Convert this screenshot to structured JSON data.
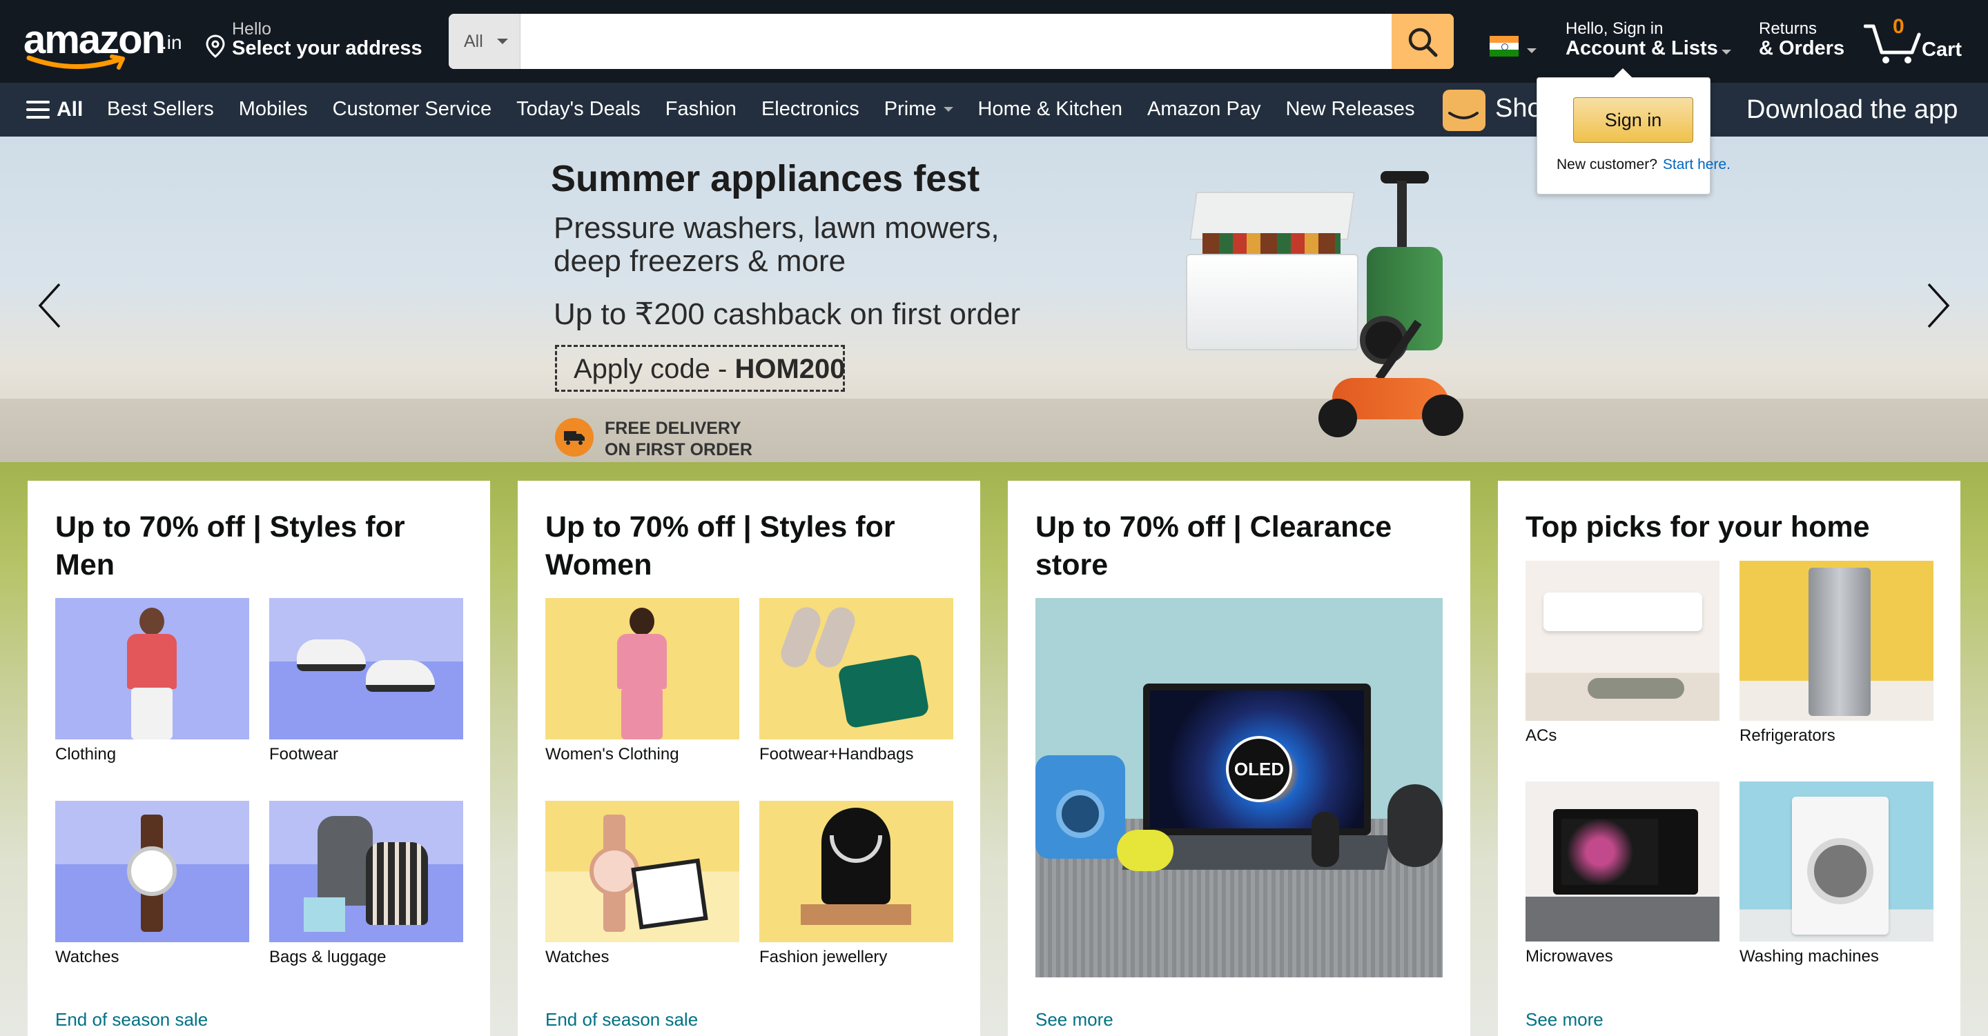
{
  "header": {
    "logo_text": "amazon",
    "logo_tld": ".in",
    "address_hello": "Hello",
    "address_label": "Select your address",
    "search_category": "All",
    "search_placeholder": "",
    "account_greeting": "Hello, Sign in",
    "account_label": "Account & Lists",
    "returns_line1": "Returns",
    "returns_line2": "& Orders",
    "cart_count": "0",
    "cart_label": "Cart"
  },
  "subnav": {
    "all_label": "All",
    "links": [
      "Best Sellers",
      "Mobiles",
      "Customer Service",
      "Today's Deals",
      "Fashion",
      "Electronics",
      "Prime",
      "Home & Kitchen",
      "Amazon Pay",
      "New Releases"
    ],
    "promo_left": "Sho",
    "promo_right": "Download the app"
  },
  "hero": {
    "title": "Summer appliances fest",
    "subtitle_line1": "Pressure washers, lawn mowers,",
    "subtitle_line2": "deep freezers & more",
    "cashback": "Up to ₹200 cashback on first order",
    "code_prefix": "Apply code - ",
    "code": "HOM200",
    "delivery_line1": "FREE DELIVERY",
    "delivery_line2": "ON FIRST ORDER"
  },
  "popover": {
    "signin_label": "Sign in",
    "new_customer": "New customer?",
    "start_here": "Start here."
  },
  "cards": [
    {
      "title": "Up to 70% off | Styles for Men",
      "tiles": [
        "Clothing",
        "Footwear",
        "Watches",
        "Bags & luggage"
      ],
      "link": "End of season sale"
    },
    {
      "title": "Up to 70% off | Styles for Women",
      "tiles": [
        "Women's Clothing",
        "Footwear+Handbags",
        "Watches",
        "Fashion jewellery"
      ],
      "link": "End of season sale"
    },
    {
      "title": "Up to 70% off | Clearance store",
      "image_badge": "OLED",
      "link": "See more"
    },
    {
      "title": "Top picks for your home",
      "tiles": [
        "ACs",
        "Refrigerators",
        "Microwaves",
        "Washing machines"
      ],
      "link": "See more"
    }
  ],
  "colors": {
    "nav_dark": "#131921",
    "nav_sub": "#232f3e",
    "search_button": "#febd69",
    "cart_count": "#f08804",
    "link": "#007185"
  }
}
